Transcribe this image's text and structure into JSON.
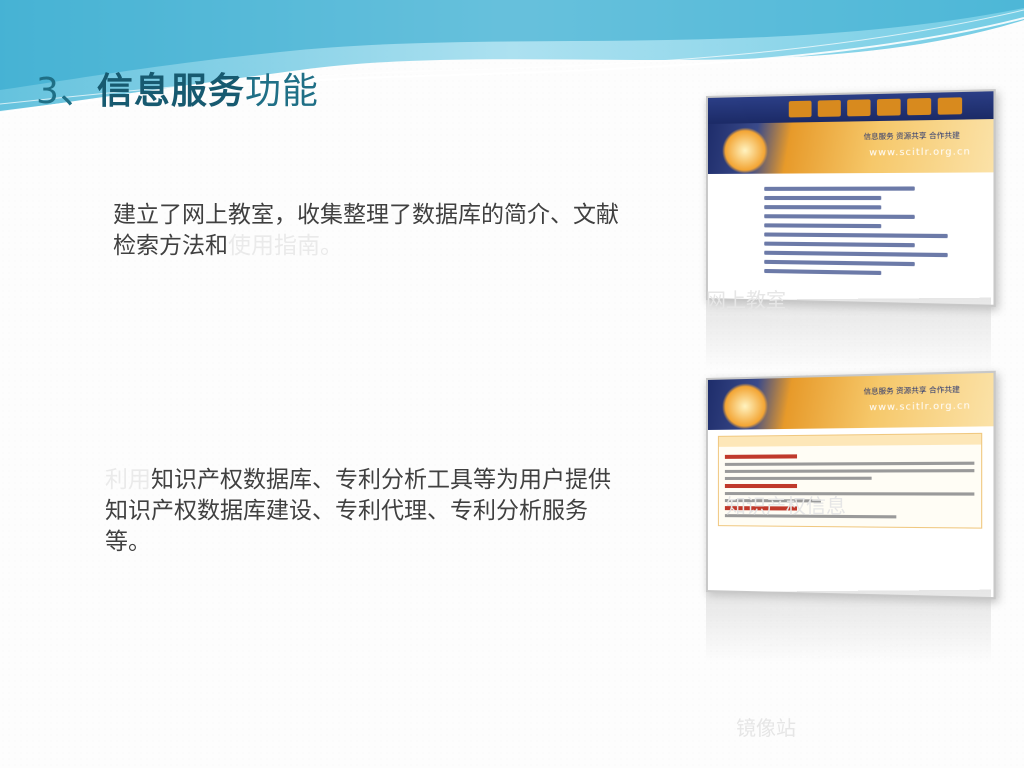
{
  "slide": {
    "title_number": "3、",
    "title_bold": "信息服务",
    "title_rest": "功能"
  },
  "paragraphs": {
    "p1_main": "建立了网上教室，收集整理了数据库的简介、文献检索方法和",
    "p1_faint": "使用指南。",
    "p2_faint": "利用",
    "p2_main": "知识产权数据库、专利分析工具等为用户提供知识产权数据库建设、专利代理、专利分析服务等。"
  },
  "captions": {
    "cap1": "网上教室",
    "cap2": "知识产权信息",
    "cap3": "镜像站"
  },
  "screenshot_site": {
    "url": "www.scitlr.org.cn",
    "slogan": "信息服务 资源共享 合作共建"
  },
  "colors": {
    "title": "#1f6f86",
    "body_text": "#404040",
    "faint_text": "#eaeaea",
    "wave": "#7fd0e8"
  }
}
